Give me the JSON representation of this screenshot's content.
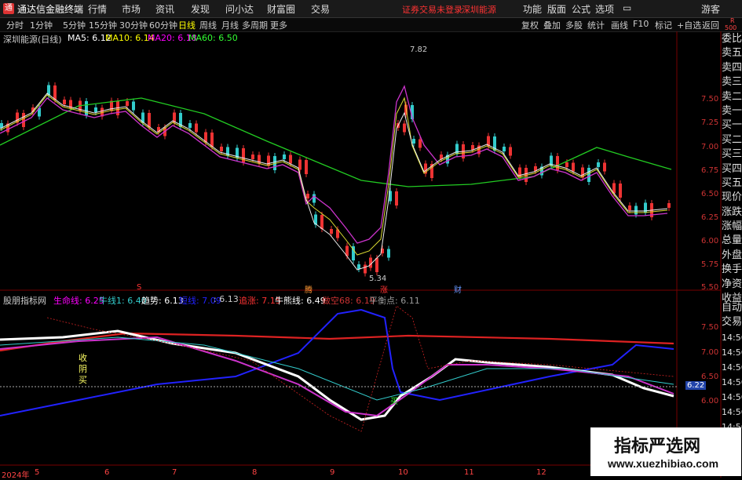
{
  "app": {
    "title": "通达信金融终端",
    "menu": [
      "行情",
      "市场",
      "资讯",
      "发现",
      "问小达",
      "财富圈",
      "交易"
    ],
    "notice": "证券交易未登录",
    "stock_link": "深圳能源",
    "right_menu": [
      "功能",
      "版面",
      "公式",
      "选项"
    ],
    "user": "游客"
  },
  "periods": [
    "分时",
    "1分钟",
    "5分钟",
    "15分钟",
    "30分钟",
    "60分钟",
    "日线",
    "周线",
    "月线",
    "多周期",
    "更多"
  ],
  "active_period": "日线",
  "tools": [
    "复权",
    "叠加",
    "多股",
    "统计",
    "画线",
    "F10",
    "标记",
    "+自选",
    "返回"
  ],
  "corner": {
    "top": "R",
    "bottom": "500"
  },
  "main_header": {
    "name": "深圳能源(日线)",
    "ma5": "MA5: 6.12",
    "ma10": "MA10: 6.14",
    "ma20": "MA20: 6.18",
    "ma60": "MA60: 6.50"
  },
  "price_axis": [
    "7.50",
    "7.25",
    "7.00",
    "6.75",
    "6.50",
    "6.25",
    "6.00",
    "5.75",
    "5.50"
  ],
  "annot": {
    "high": "7.82",
    "low": "5.34"
  },
  "markers": {
    "s": "S",
    "m1": "腾",
    "m2": "涨",
    "m3": "财"
  },
  "sub_header": {
    "name": "股朋指标网",
    "sm": "生命线: 6.25",
    "nx1": "牛线1: 6.40",
    "qs": "趋势: 6.13",
    "qx": "短线: 7.09",
    "v613": ": 6.13",
    "zz": "追涨: 7.15",
    "nxx": "牛熊线: 6.49",
    "zk": "做空68: 6.19",
    "phd": "平衡点: 6.11"
  },
  "sub_axis": [
    "7.50",
    "7.00",
    "6.50",
    "6.00"
  ],
  "sub_tag": "6.22",
  "sub_text": "收阴买",
  "sub_mark": "买",
  "right_panel": [
    "委比",
    "卖五",
    "卖四",
    "卖三",
    "卖二",
    "卖一",
    "买一",
    "买二",
    "买三",
    "买四",
    "买五",
    "现价",
    "涨跌",
    "涨幅",
    "总量",
    "外盘",
    "换手",
    "净资",
    "收益",
    "自动",
    "交易"
  ],
  "right_times": [
    "14:56",
    "14:56",
    "14:56",
    "14:56",
    "14:56",
    "14:56",
    "14:56"
  ],
  "date_axis": [
    "2024年",
    "5",
    "6",
    "7",
    "8",
    "9",
    "10",
    "11",
    "12"
  ],
  "watermark": {
    "title": "指标严选网",
    "url": "www.xuezhibiao.com"
  },
  "chart_data": {
    "type": "line",
    "ylim": [
      5.3,
      7.9
    ],
    "series": [
      {
        "name": "MA60",
        "values": [
          6.8,
          7.1,
          7.35,
          7.38,
          7.3,
          7.1,
          6.8,
          6.5,
          6.55,
          6.7,
          6.62,
          6.5
        ]
      }
    ]
  }
}
